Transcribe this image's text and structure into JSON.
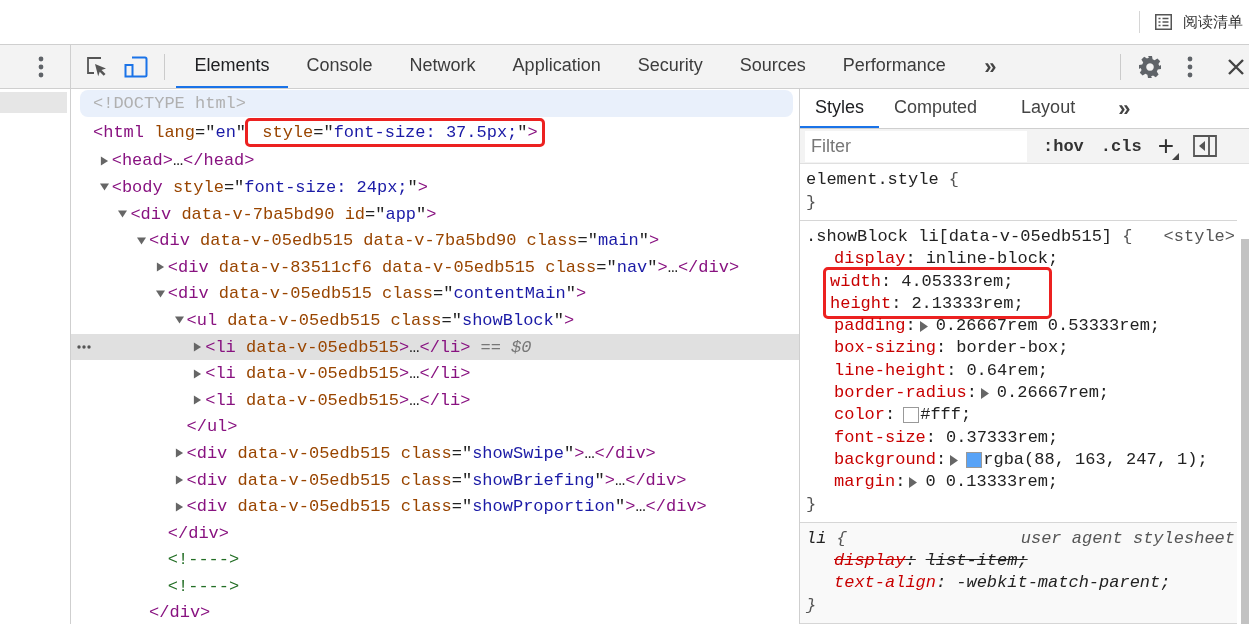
{
  "browser_bar": {
    "reading_list": "阅读清单"
  },
  "toolbar": {
    "tabs": [
      {
        "label": "Elements",
        "selected": true
      },
      {
        "label": "Console",
        "selected": false
      },
      {
        "label": "Network",
        "selected": false
      },
      {
        "label": "Application",
        "selected": false
      },
      {
        "label": "Security",
        "selected": false
      },
      {
        "label": "Sources",
        "selected": false
      },
      {
        "label": "Performance",
        "selected": false
      }
    ],
    "more": "»"
  },
  "elements": {
    "tree": [
      {
        "hovered": true,
        "selected": false,
        "parts": [
          {
            "text": "<!DOCTYPE html>",
            "kind": "doctype"
          }
        ]
      },
      {
        "hovered": false,
        "selected": false,
        "parts": [
          {
            "text": "<html",
            "kind": "tag"
          },
          {
            "text": " lang",
            "kind": "attr"
          },
          {
            "text": "=\"",
            "kind": "punct"
          },
          {
            "text": "en",
            "kind": "value"
          },
          {
            "text": "\"",
            "kind": "punct"
          },
          {
            "kind": "group",
            "boxed": true,
            "parts": [
              {
                "text": " style",
                "kind": "attr"
              },
              {
                "text": "=\"",
                "kind": "punct"
              },
              {
                "text": "font-size: 37.5px;",
                "kind": "value"
              },
              {
                "text": "\"",
                "kind": "punct"
              },
              {
                "text": ">",
                "kind": "tag"
              }
            ]
          }
        ],
        "children": [
          {
            "hovered": false,
            "selected": false,
            "expanded": false,
            "parts": [
              {
                "text": "<head>",
                "kind": "tag"
              },
              {
                "text": "…",
                "kind": "punct"
              },
              {
                "text": "</head>",
                "kind": "tag"
              }
            ]
          },
          {
            "hovered": false,
            "selected": false,
            "expanded": true,
            "parts": [
              {
                "text": "<body",
                "kind": "tag"
              },
              {
                "text": " style",
                "kind": "attr"
              },
              {
                "text": "=\"",
                "kind": "punct"
              },
              {
                "text": "font-size: 24px;",
                "kind": "value"
              },
              {
                "text": "\"",
                "kind": "punct"
              },
              {
                "text": ">",
                "kind": "tag"
              }
            ],
            "children": [
              {
                "hovered": false,
                "selected": false,
                "expanded": true,
                "parts": [
                  {
                    "text": "<div",
                    "kind": "tag"
                  },
                  {
                    "text": " data-v-7ba5bd90 id",
                    "kind": "attr"
                  },
                  {
                    "text": "=\"",
                    "kind": "punct"
                  },
                  {
                    "text": "app",
                    "kind": "value"
                  },
                  {
                    "text": "\"",
                    "kind": "punct"
                  },
                  {
                    "text": ">",
                    "kind": "tag"
                  }
                ],
                "children": [
                  {
                    "hovered": false,
                    "selected": false,
                    "expanded": true,
                    "parts": [
                      {
                        "text": "<div",
                        "kind": "tag"
                      },
                      {
                        "text": " data-v-05edb515 data-v-7ba5bd90 class",
                        "kind": "attr"
                      },
                      {
                        "text": "=\"",
                        "kind": "punct"
                      },
                      {
                        "text": "main",
                        "kind": "value"
                      },
                      {
                        "text": "\"",
                        "kind": "punct"
                      },
                      {
                        "text": ">",
                        "kind": "tag"
                      }
                    ],
                    "children": [
                      {
                        "hovered": false,
                        "selected": false,
                        "expanded": false,
                        "parts": [
                          {
                            "text": "<div",
                            "kind": "tag"
                          },
                          {
                            "text": " data-v-83511cf6 data-v-05edb515 class",
                            "kind": "attr"
                          },
                          {
                            "text": "=\"",
                            "kind": "punct"
                          },
                          {
                            "text": "nav",
                            "kind": "value"
                          },
                          {
                            "text": "\"",
                            "kind": "punct"
                          },
                          {
                            "text": ">",
                            "kind": "tag"
                          },
                          {
                            "text": "…",
                            "kind": "punct"
                          },
                          {
                            "text": "</div>",
                            "kind": "tag"
                          }
                        ]
                      },
                      {
                        "hovered": false,
                        "selected": false,
                        "expanded": true,
                        "parts": [
                          {
                            "text": "<div",
                            "kind": "tag"
                          },
                          {
                            "text": " data-v-05edb515 class",
                            "kind": "attr"
                          },
                          {
                            "text": "=\"",
                            "kind": "punct"
                          },
                          {
                            "text": "contentMain",
                            "kind": "value"
                          },
                          {
                            "text": "\"",
                            "kind": "punct"
                          },
                          {
                            "text": ">",
                            "kind": "tag"
                          }
                        ],
                        "children": [
                          {
                            "hovered": false,
                            "selected": false,
                            "expanded": true,
                            "parts": [
                              {
                                "text": "<ul",
                                "kind": "tag"
                              },
                              {
                                "text": " data-v-05edb515 class",
                                "kind": "attr"
                              },
                              {
                                "text": "=\"",
                                "kind": "punct"
                              },
                              {
                                "text": "showBlock",
                                "kind": "value"
                              },
                              {
                                "text": "\"",
                                "kind": "punct"
                              },
                              {
                                "text": ">",
                                "kind": "tag"
                              }
                            ],
                            "children": [
                              {
                                "hovered": false,
                                "selected": true,
                                "expanded": false,
                                "reference": "== $0",
                                "parts": [
                                  {
                                    "text": "<li",
                                    "kind": "tag"
                                  },
                                  {
                                    "text": " data-v-05edb515",
                                    "kind": "attr"
                                  },
                                  {
                                    "text": ">",
                                    "kind": "tag"
                                  },
                                  {
                                    "text": "…",
                                    "kind": "punct"
                                  },
                                  {
                                    "text": "</li>",
                                    "kind": "tag"
                                  }
                                ]
                              },
                              {
                                "hovered": false,
                                "selected": false,
                                "expanded": false,
                                "parts": [
                                  {
                                    "text": "<li",
                                    "kind": "tag"
                                  },
                                  {
                                    "text": " data-v-05edb515",
                                    "kind": "attr"
                                  },
                                  {
                                    "text": ">",
                                    "kind": "tag"
                                  },
                                  {
                                    "text": "…",
                                    "kind": "punct"
                                  },
                                  {
                                    "text": "</li>",
                                    "kind": "tag"
                                  }
                                ]
                              },
                              {
                                "hovered": false,
                                "selected": false,
                                "expanded": false,
                                "parts": [
                                  {
                                    "text": "<li",
                                    "kind": "tag"
                                  },
                                  {
                                    "text": " data-v-05edb515",
                                    "kind": "attr"
                                  },
                                  {
                                    "text": ">",
                                    "kind": "tag"
                                  },
                                  {
                                    "text": "…",
                                    "kind": "punct"
                                  },
                                  {
                                    "text": "</li>",
                                    "kind": "tag"
                                  }
                                ]
                              }
                            ],
                            "end": [
                              {
                                "text": "</ul>",
                                "kind": "tag"
                              }
                            ]
                          },
                          {
                            "hovered": false,
                            "selected": false,
                            "expanded": false,
                            "parts": [
                              {
                                "text": "<div",
                                "kind": "tag"
                              },
                              {
                                "text": " data-v-05edb515 class",
                                "kind": "attr"
                              },
                              {
                                "text": "=\"",
                                "kind": "punct"
                              },
                              {
                                "text": "showSwipe",
                                "kind": "value"
                              },
                              {
                                "text": "\"",
                                "kind": "punct"
                              },
                              {
                                "text": ">",
                                "kind": "tag"
                              },
                              {
                                "text": "…",
                                "kind": "punct"
                              },
                              {
                                "text": "</div>",
                                "kind": "tag"
                              }
                            ]
                          },
                          {
                            "hovered": false,
                            "selected": false,
                            "expanded": false,
                            "parts": [
                              {
                                "text": "<div",
                                "kind": "tag"
                              },
                              {
                                "text": " data-v-05edb515 class",
                                "kind": "attr"
                              },
                              {
                                "text": "=\"",
                                "kind": "punct"
                              },
                              {
                                "text": "showBriefing",
                                "kind": "value"
                              },
                              {
                                "text": "\"",
                                "kind": "punct"
                              },
                              {
                                "text": ">",
                                "kind": "tag"
                              },
                              {
                                "text": "…",
                                "kind": "punct"
                              },
                              {
                                "text": "</div>",
                                "kind": "tag"
                              }
                            ]
                          },
                          {
                            "hovered": false,
                            "selected": false,
                            "expanded": false,
                            "parts": [
                              {
                                "text": "<div",
                                "kind": "tag"
                              },
                              {
                                "text": " data-v-05edb515 class",
                                "kind": "attr"
                              },
                              {
                                "text": "=\"",
                                "kind": "punct"
                              },
                              {
                                "text": "showProportion",
                                "kind": "value"
                              },
                              {
                                "text": "\"",
                                "kind": "punct"
                              },
                              {
                                "text": ">",
                                "kind": "tag"
                              },
                              {
                                "text": "…",
                                "kind": "punct"
                              },
                              {
                                "text": "</div>",
                                "kind": "tag"
                              }
                            ]
                          }
                        ],
                        "end": [
                          {
                            "text": "</div>",
                            "kind": "tag"
                          }
                        ]
                      },
                      {
                        "hovered": false,
                        "selected": false,
                        "parts": [
                          {
                            "text": "<!---->",
                            "kind": "comment"
                          }
                        ]
                      },
                      {
                        "hovered": false,
                        "selected": false,
                        "parts": [
                          {
                            "text": "<!---->",
                            "kind": "comment"
                          }
                        ]
                      }
                    ],
                    "end": [
                      {
                        "text": "</div>",
                        "kind": "tag"
                      }
                    ]
                  }
                ]
              }
            ]
          }
        ]
      }
    ]
  },
  "styles": {
    "tabs": [
      {
        "label": "Styles",
        "selected": true
      },
      {
        "label": "Computed",
        "selected": false
      },
      {
        "label": "Layout",
        "selected": false
      }
    ],
    "more": "»",
    "filter": {
      "placeholder": "Filter"
    },
    "buttons": [
      {
        "label": ":hov",
        "kind": "toggle"
      },
      {
        "label": ".cls",
        "kind": "toggle"
      },
      {
        "label": "+",
        "kind": "menu"
      }
    ],
    "rules": [
      {
        "kind": "inline",
        "selector": "element.style",
        "open": " {",
        "close": "}"
      },
      {
        "kind": "author",
        "selector": ".showBlock li[data-v-05edb515]",
        "open": " {",
        "source": "<style>",
        "close": "}",
        "declarations": [
          {
            "property": "display",
            "colon": ":",
            "value": "inline-block;",
            "expandable": false,
            "boxed": false,
            "overridden": false
          },
          {
            "property": "width",
            "colon": ":",
            "value": "4.05333rem;",
            "expandable": false,
            "boxed": true,
            "overridden": false
          },
          {
            "property": "height",
            "colon": ":",
            "value": "2.13333rem;",
            "expandable": false,
            "boxed": true,
            "overridden": false
          },
          {
            "property": "padding",
            "colon": ":",
            "value": "0.26667rem 0.53333rem;",
            "expandable": true,
            "boxed": false,
            "overridden": false
          },
          {
            "property": "box-sizing",
            "colon": ":",
            "value": "border-box;",
            "expandable": false,
            "boxed": false,
            "overridden": false
          },
          {
            "property": "line-height",
            "colon": ":",
            "value": "0.64rem;",
            "expandable": false,
            "boxed": false,
            "overridden": false
          },
          {
            "property": "border-radius",
            "colon": ":",
            "value": "0.26667rem;",
            "expandable": true,
            "boxed": false,
            "overridden": false
          },
          {
            "property": "color",
            "colon": ":",
            "value": "#fff;",
            "color": "#ffffff",
            "expandable": false,
            "boxed": false,
            "overridden": false
          },
          {
            "property": "font-size",
            "colon": ":",
            "value": "0.37333rem;",
            "expandable": false,
            "boxed": false,
            "overridden": false
          },
          {
            "property": "background",
            "colon": ":",
            "value": "rgba(88, 163, 247, 1);",
            "color": "#58a3f7",
            "expandable": true,
            "boxed": false,
            "overridden": false
          },
          {
            "property": "margin",
            "colon": ":",
            "value": "0 0.13333rem;",
            "expandable": true,
            "boxed": false,
            "overridden": false
          }
        ]
      },
      {
        "kind": "user-agent",
        "selector": "li",
        "open": " {",
        "source": "user agent stylesheet",
        "close": "}",
        "declarations": [
          {
            "property": "display",
            "colon": ":",
            "value": "list-item;",
            "expandable": false,
            "boxed": false,
            "overridden": true
          },
          {
            "property": "text-align",
            "colon": ":",
            "value": "-webkit-match-parent;",
            "expandable": false,
            "boxed": false,
            "overridden": false
          }
        ]
      }
    ]
  }
}
